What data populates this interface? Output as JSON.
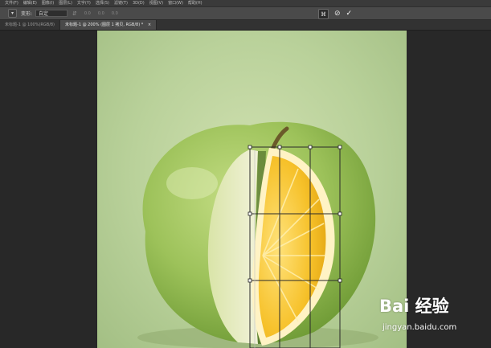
{
  "app": {
    "menu": [
      "文件(F)",
      "编辑(E)",
      "图像(I)",
      "图层(L)",
      "文字(Y)",
      "选择(S)",
      "滤镜(T)",
      "3D(D)",
      "视图(V)",
      "窗口(W)",
      "帮助(H)"
    ]
  },
  "options_bar": {
    "tool_icon": "warp-tool-icon",
    "warp_label": "变形:",
    "warp_value": "自定",
    "grayed_values": [
      "0.0",
      "0.0",
      "0.0"
    ],
    "warp_mode_icon": "warp-mode-icon",
    "cancel_icon": "cancel-transform-icon",
    "commit_icon": "commit-transform-icon"
  },
  "tabs": [
    {
      "label": "未标题-1 @ 100%(RGB/8)",
      "active": false
    },
    {
      "label": "未标题-1 @ 200% (图层 1 拷贝, RGB/8) *",
      "active": true
    }
  ],
  "canvas": {
    "subject": "green apple with lemon slice",
    "colors": {
      "background": "#b9d19a",
      "apple": "#9dc25a",
      "apple_flesh": "#e8ecc8",
      "lemon": "#f6c12a",
      "lemon_rind": "#fff3c4"
    },
    "transform_grid": "3x3 warp grid"
  },
  "watermark": {
    "logo": "Bai 经验",
    "url": "jingyan.baidu.com"
  }
}
